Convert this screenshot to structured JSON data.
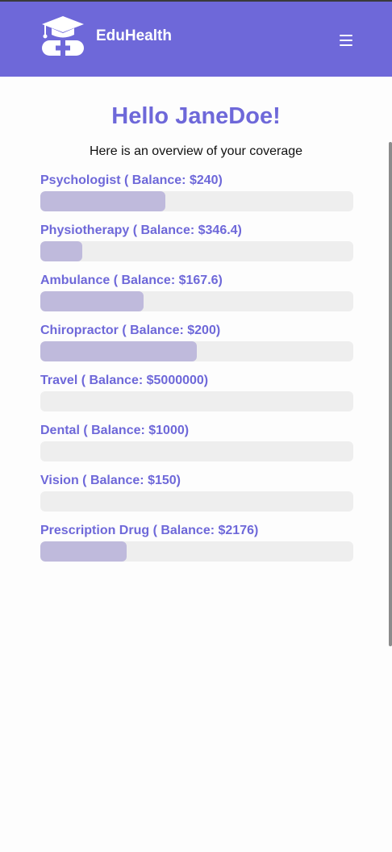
{
  "header": {
    "brand": "EduHealth",
    "logo_icon": "graduation-cap-health-icon",
    "menu_icon": "hamburger-menu-icon",
    "color": "#6e68d9"
  },
  "main": {
    "greeting": "Hello JaneDoe!",
    "subtitle": "Here is an overview of your coverage",
    "coverages": [
      {
        "label": "Psychologist ( Balance: $240)",
        "used_fraction": 0.4
      },
      {
        "label": "Physiotherapy ( Balance: $346.4)",
        "used_fraction": 0.135
      },
      {
        "label": "Ambulance ( Balance: $167.6)",
        "used_fraction": 0.33
      },
      {
        "label": "Chiropractor ( Balance: $200)",
        "used_fraction": 0.5
      },
      {
        "label": "Travel ( Balance: $5000000)",
        "used_fraction": 0
      },
      {
        "label": "Dental ( Balance: $1000)",
        "used_fraction": 0
      },
      {
        "label": "Vision ( Balance: $150)",
        "used_fraction": 0
      },
      {
        "label": "Prescription Drug ( Balance: $2176)",
        "used_fraction": 0.275
      }
    ],
    "bar_fill_color": "#bfbadc",
    "bar_track_color": "#eeeeee"
  }
}
